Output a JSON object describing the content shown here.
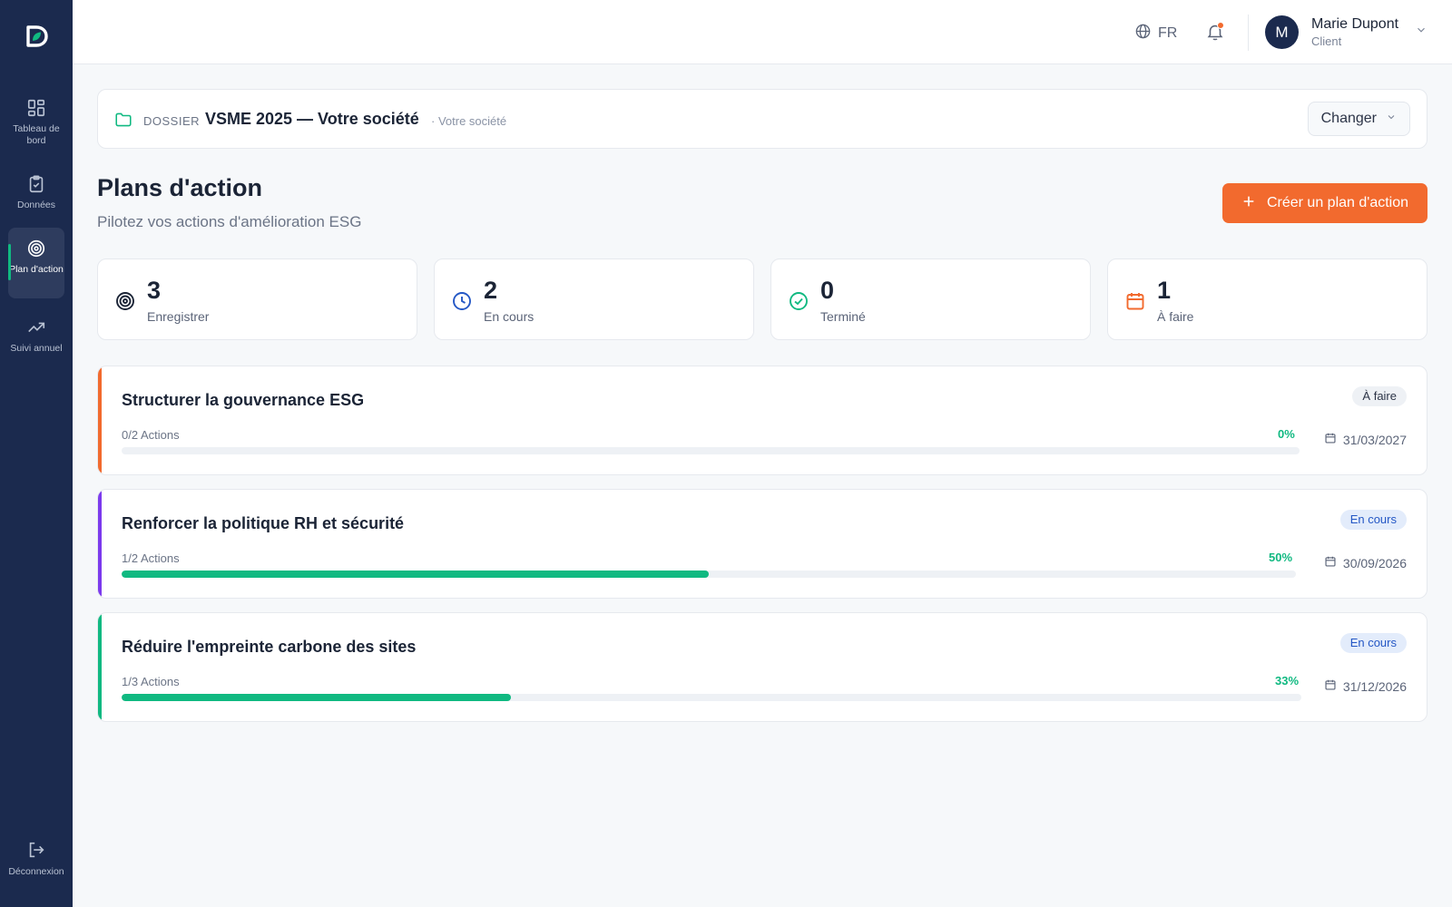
{
  "sidebar": {
    "items": [
      {
        "label": "Tableau de bord",
        "icon": "grid-icon"
      },
      {
        "label": "Données",
        "icon": "clipboard-check-icon"
      },
      {
        "label": "Plan d'action",
        "icon": "target-icon",
        "active": true
      },
      {
        "label": "Suivi annuel",
        "icon": "trending-up-icon"
      }
    ],
    "logout_label": "Déconnexion"
  },
  "topbar": {
    "language": "FR",
    "user": {
      "initial": "M",
      "name": "Marie Dupont",
      "role": "Client"
    }
  },
  "dossier": {
    "tag": "DOSSIER",
    "title": "VSME 2025 — Votre société",
    "subtitle": "· Votre société",
    "change_label": "Changer"
  },
  "page": {
    "title": "Plans d'action",
    "subtitle": "Pilotez vos actions d'amélioration ESG",
    "create_label": "Créer un plan d'action"
  },
  "stats": [
    {
      "value": "3",
      "label": "Enregistrer",
      "icon": "target-icon",
      "color": "#1b2436"
    },
    {
      "value": "2",
      "label": "En cours",
      "icon": "clock-icon",
      "color": "#2457c5"
    },
    {
      "value": "0",
      "label": "Terminé",
      "icon": "check-circle-icon",
      "color": "#10b981"
    },
    {
      "value": "1",
      "label": "À faire",
      "icon": "calendar-icon",
      "color": "#f26a2e"
    }
  ],
  "plans": [
    {
      "title": "Structurer la gouvernance ESG",
      "status": "À faire",
      "actions": "0/2 Actions",
      "progress_label": "0%",
      "progress": 0,
      "date": "31/03/2027",
      "accent": "#f26a2e"
    },
    {
      "title": "Renforcer la politique RH et sécurité",
      "status": "En cours",
      "actions": "1/2 Actions",
      "progress_label": "50%",
      "progress": 50,
      "date": "30/09/2026",
      "accent": "#7c3aed"
    },
    {
      "title": "Réduire l'empreinte carbone des sites",
      "status": "En cours",
      "actions": "1/3 Actions",
      "progress_label": "33%",
      "progress": 33,
      "date": "31/12/2026",
      "accent": "#10b981"
    }
  ]
}
